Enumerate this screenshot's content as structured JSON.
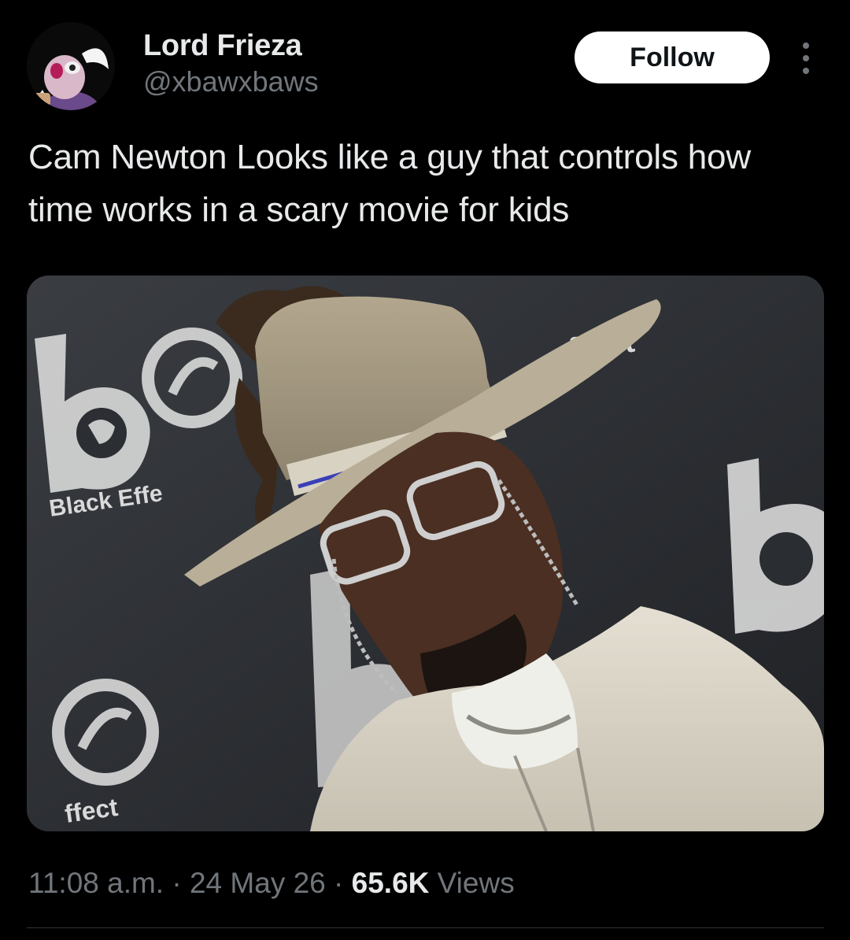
{
  "author": {
    "display_name": "Lord Frieza",
    "handle": "@xbawxbaws"
  },
  "actions": {
    "follow_label": "Follow",
    "more_icon": "more-vertical-icon"
  },
  "tweet": {
    "text": "Cam Newton Looks like a guy that controls how time works in a scary movie for kids"
  },
  "media": {
    "backdrop_texts": {
      "left_logo": "be",
      "left_caption": "Black Effe",
      "top_right": "ffect",
      "bottom_left": "ffect"
    }
  },
  "meta": {
    "time": "11:08 a.m.",
    "separator": "·",
    "date": "24 May 26",
    "views_count": "65.6K",
    "views_label": "Views"
  },
  "colors": {
    "background": "#000000",
    "primary_text": "#e7e9ea",
    "secondary_text": "#71767b",
    "follow_bg": "#ffffff",
    "follow_text": "#0f1419"
  }
}
